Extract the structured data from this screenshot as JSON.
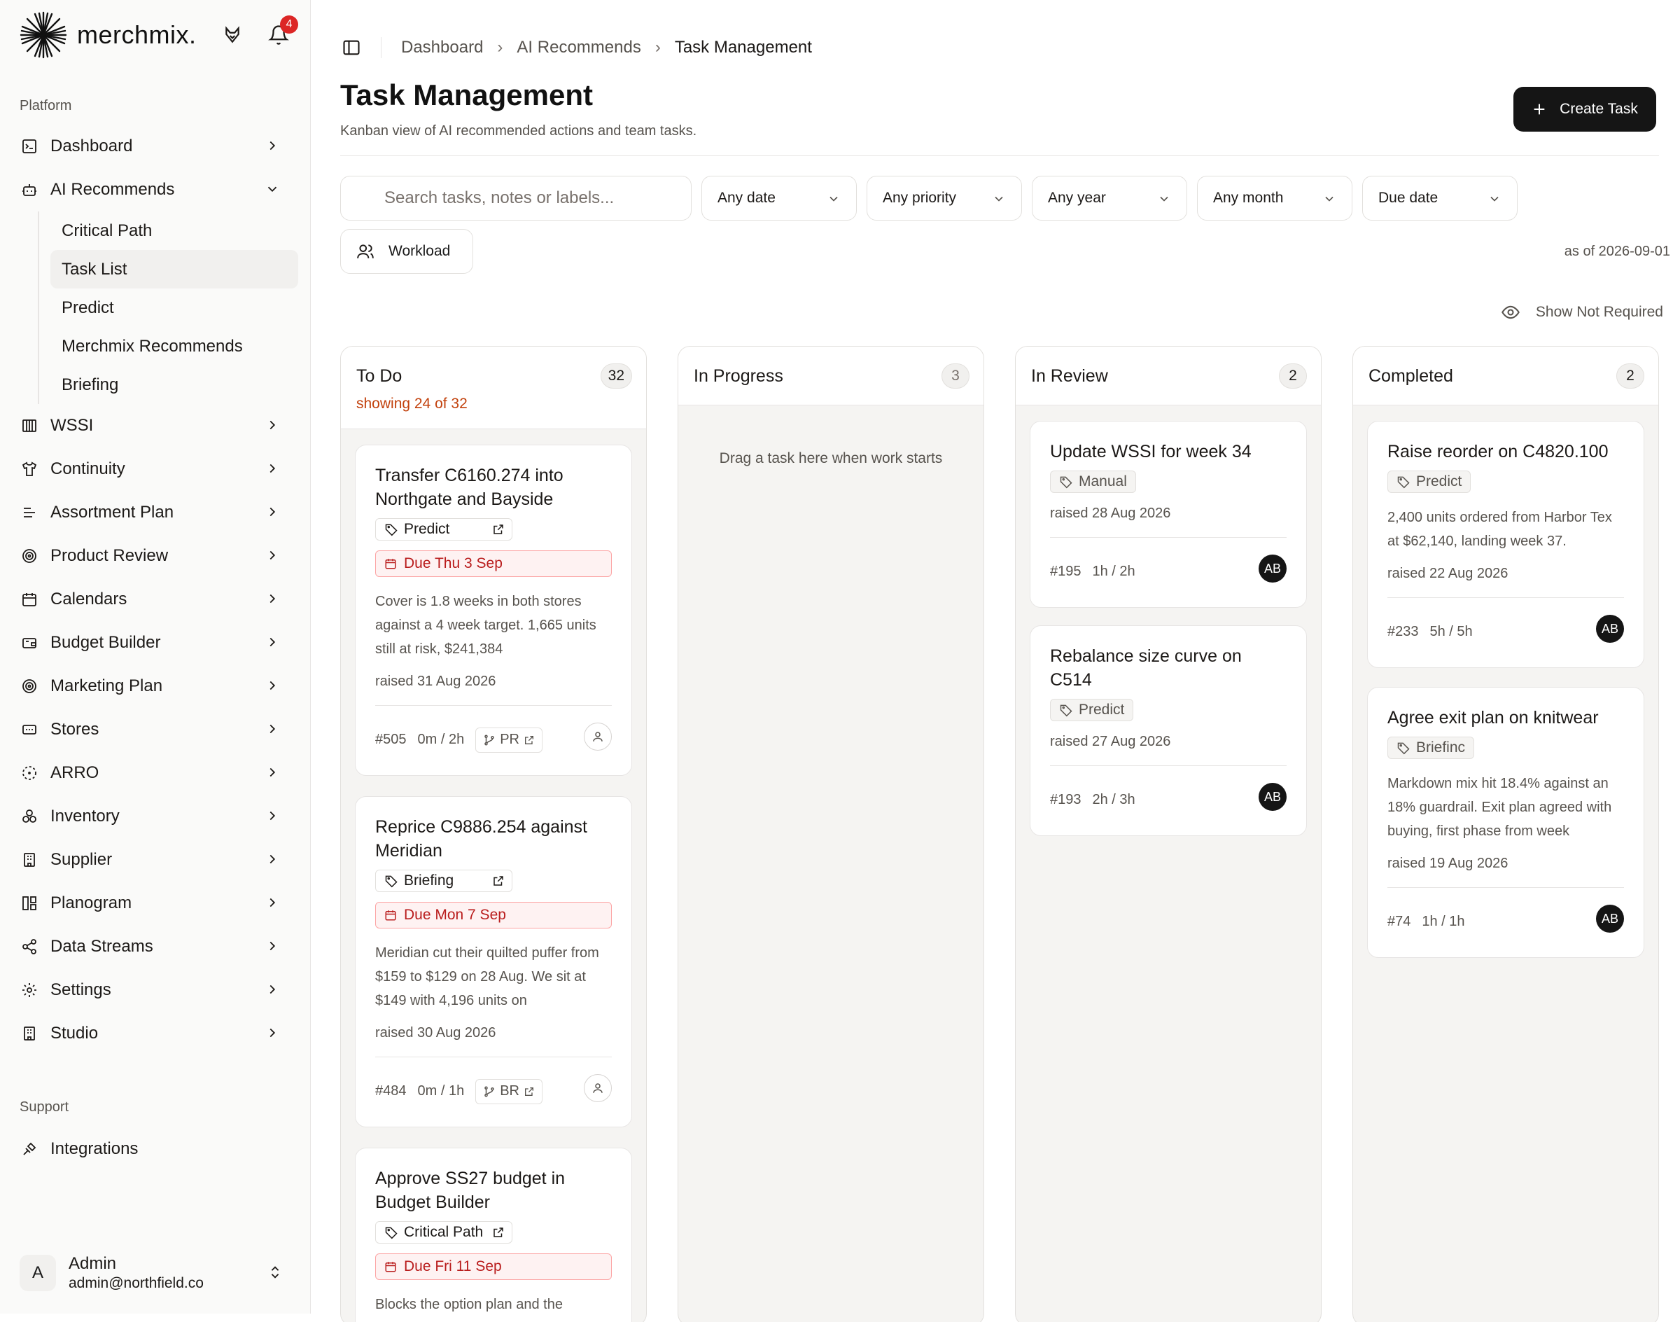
{
  "brand": {
    "name": "merchmix.",
    "notifications": "4"
  },
  "sidebar": {
    "platform_label": "Platform",
    "support_label": "Support",
    "items": [
      {
        "label": "Dashboard",
        "icon": "terminal-icon"
      },
      {
        "label": "AI Recommends",
        "icon": "bot-icon"
      },
      {
        "label": "WSSI",
        "icon": "columns-icon"
      },
      {
        "label": "Continuity",
        "icon": "shirt-icon"
      },
      {
        "label": "Assortment Plan",
        "icon": "list-icon"
      },
      {
        "label": "Product Review",
        "icon": "target-icon"
      },
      {
        "label": "Calendars",
        "icon": "calendar-icon"
      },
      {
        "label": "Budget Builder",
        "icon": "wallet-icon"
      },
      {
        "label": "Marketing Plan",
        "icon": "target-icon"
      },
      {
        "label": "Stores",
        "icon": "store-icon"
      },
      {
        "label": "ARRO",
        "icon": "dashed-circle-icon"
      },
      {
        "label": "Inventory",
        "icon": "boxes-icon"
      },
      {
        "label": "Supplier",
        "icon": "building-icon"
      },
      {
        "label": "Planogram",
        "icon": "layout-icon"
      },
      {
        "label": "Data Streams",
        "icon": "share-icon"
      },
      {
        "label": "Settings",
        "icon": "gear-icon"
      },
      {
        "label": "Studio",
        "icon": "building-icon"
      }
    ],
    "sub_items": [
      "Critical Path",
      "Task List",
      "Predict",
      "Merchmix Recommends",
      "Briefing"
    ],
    "support_items": [
      {
        "label": "Integrations",
        "icon": "plug-icon"
      }
    ],
    "user": {
      "initial": "A",
      "name": "Admin",
      "email": "admin@northfield.co"
    }
  },
  "breadcrumb": [
    "Dashboard",
    "AI Recommends",
    "Task Management"
  ],
  "header": {
    "title": "Task Management",
    "subtitle": "Kanban view of AI recommended actions and team tasks.",
    "create_label": "Create Task"
  },
  "filters": {
    "search_placeholder": "Search tasks, notes or labels...",
    "date": "Any date",
    "priority": "Any priority",
    "year": "Any year",
    "month": "Any month",
    "due": "Due date",
    "workload": "Workload",
    "as_of": "as of 2026-09-01",
    "show_not_required": "Show Not Required"
  },
  "columns": {
    "todo": {
      "title": "To Do",
      "count": "32",
      "showing": "showing 24 of 32",
      "cards": [
        {
          "title": "Transfer C6160.274 into Northgate and Bayside",
          "tag": "Predict",
          "due": "Due Thu 3 Sep",
          "desc": "Cover is 1.8 weeks in both stores against a 4 week target. 1,665 units still at risk, $241,384",
          "raised": "raised 31 Aug 2026",
          "id": "#505",
          "time": "0m / 2h",
          "pr": "PR"
        },
        {
          "title": "Reprice C9886.254 against Meridian",
          "tag": "Briefing",
          "due": "Due Mon 7 Sep",
          "desc": "Meridian cut their quilted puffer from $159 to $129 on 28 Aug. We sit at $149 with 4,196 units on",
          "raised": "raised 30 Aug 2026",
          "id": "#484",
          "time": "0m / 1h",
          "pr": "BR"
        },
        {
          "title": "Approve SS27 budget in Budget Builder",
          "tag": "Critical Path",
          "due": "Due Fri 11 Sep",
          "desc": "Blocks the option plan and the"
        }
      ]
    },
    "progress": {
      "title": "In Progress",
      "count": "3",
      "empty": "Drag a task here when work starts"
    },
    "review": {
      "title": "In Review",
      "count": "2",
      "cards": [
        {
          "title": "Update WSSI for week 34",
          "tag": "Manual",
          "raised": "raised 28 Aug 2026",
          "id": "#195",
          "time": "1h / 2h",
          "avatar": "AB"
        },
        {
          "title": "Rebalance size curve on C514",
          "tag": "Predict",
          "raised": "raised 27 Aug 2026",
          "id": "#193",
          "time": "2h / 3h",
          "avatar": "AB"
        }
      ]
    },
    "completed": {
      "title": "Completed",
      "count": "2",
      "cards": [
        {
          "title": "Raise reorder on C4820.100",
          "tag": "Predict",
          "desc": "2,400 units ordered from Harbor Tex at $62,140, landing week 37.",
          "raised": "raised 22 Aug 2026",
          "id": "#233",
          "time": "5h / 5h",
          "avatar": "AB"
        },
        {
          "title": "Agree exit plan on knitwear",
          "tag": "Briefinc",
          "desc": "Markdown mix hit 18.4% against an 18% guardrail. Exit plan agreed with buying, first phase from week",
          "raised": "raised 19 Aug 2026",
          "id": "#74",
          "time": "1h / 1h",
          "avatar": "AB"
        }
      ]
    }
  }
}
